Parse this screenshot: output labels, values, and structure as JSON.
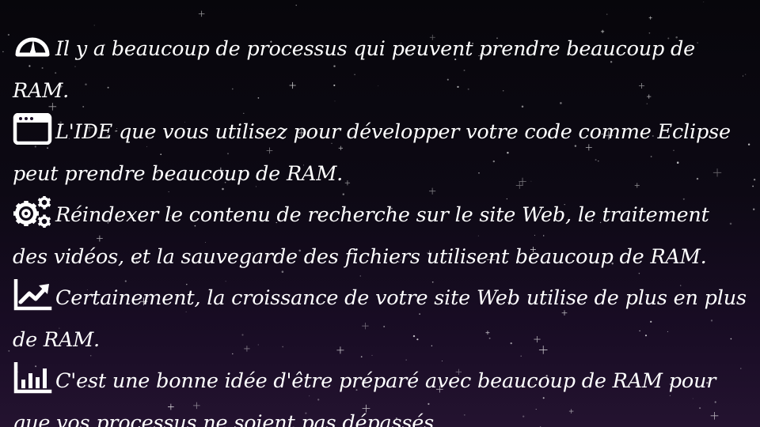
{
  "slide": {
    "items": [
      {
        "icon": "gauge-icon",
        "text": "Il y a beaucoup de processus qui peuvent prendre beaucoup de RAM."
      },
      {
        "icon": "browser-window-icon",
        "text": "L'IDE que vous utilisez pour développer votre code comme Eclipse peut prendre beaucoup de RAM."
      },
      {
        "icon": "gears-icon",
        "text": "Réindexer le contenu de recherche sur le site Web, le traitement des vidéos, et la sauvegarde des fichiers utilisent beaucoup de RAM."
      },
      {
        "icon": "trending-up-icon",
        "text": "Certainement, la croissance de votre site Web utilise de plus en plus de RAM."
      },
      {
        "icon": "bar-chart-icon",
        "text": "C'est une bonne idée d'être préparé avec beaucoup de RAM pour que vos processus ne soient pas dépassés."
      }
    ]
  },
  "colors": {
    "background_top": "#07060b",
    "background_bottom": "#241330",
    "text": "#ffffff",
    "stars": "#ffffff"
  }
}
